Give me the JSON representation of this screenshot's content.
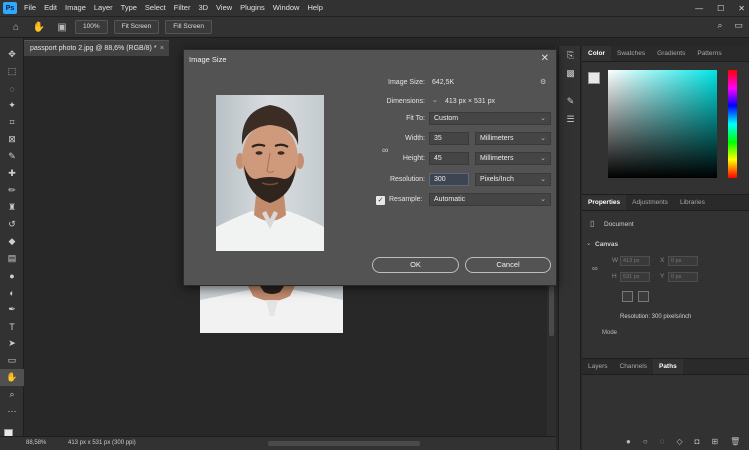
{
  "menu": {
    "logo": "Ps",
    "items": [
      "File",
      "Edit",
      "Image",
      "Layer",
      "Type",
      "Select",
      "Filter",
      "3D",
      "View",
      "Plugins",
      "Window",
      "Help"
    ],
    "window_controls": [
      "—",
      "☐",
      "✕"
    ]
  },
  "options": {
    "zoom_pct": "100%",
    "fit_screen": "Fit Screen",
    "fill_screen": "Fill Screen"
  },
  "document": {
    "tab_title": "passport photo 2.jpg @ 88,6% (RGB/8) *",
    "close": "×"
  },
  "status": {
    "zoom": "88,58%",
    "dimensions": "413 px x 531 px (300 ppi)"
  },
  "dialog": {
    "title": "Image Size",
    "close": "✕",
    "image_size_label": "Image Size:",
    "image_size_value": "642,5K",
    "gear_icon": "⚙",
    "dimensions_label": "Dimensions:",
    "dimensions_value": "413 px × 531 px",
    "fit_to_label": "Fit To:",
    "fit_to_value": "Custom",
    "width_label": "Width:",
    "width_value": "35",
    "width_unit": "Millimeters",
    "height_label": "Height:",
    "height_value": "45",
    "height_unit": "Millimeters",
    "resolution_label": "Resolution:",
    "resolution_value": "300",
    "resolution_unit": "Pixels/Inch",
    "resample_label": "Resample:",
    "resample_value": "Automatic",
    "ok_label": "OK",
    "cancel_label": "Cancel"
  },
  "panels": {
    "color_tabs": [
      "Color",
      "Swatches",
      "Gradients",
      "Patterns"
    ],
    "props_tabs": [
      "Properties",
      "Adjustments",
      "Libraries"
    ],
    "document_label": "Document",
    "canvas_label": "Canvas",
    "w_label": "W",
    "w_value": "413 px",
    "h_label": "H",
    "h_value": "531 px",
    "x_label": "X",
    "x_value": "0 px",
    "y_label": "Y",
    "y_value": "0 px",
    "resolution_text": "Resolution: 300 pixels/inch",
    "mode_label": "Mode",
    "layers_tabs": [
      "Layers",
      "Channels",
      "Paths"
    ]
  },
  "colors": {
    "accent": "#31a8ff",
    "panel_bg": "#323232",
    "dialog_bg": "#535353"
  }
}
